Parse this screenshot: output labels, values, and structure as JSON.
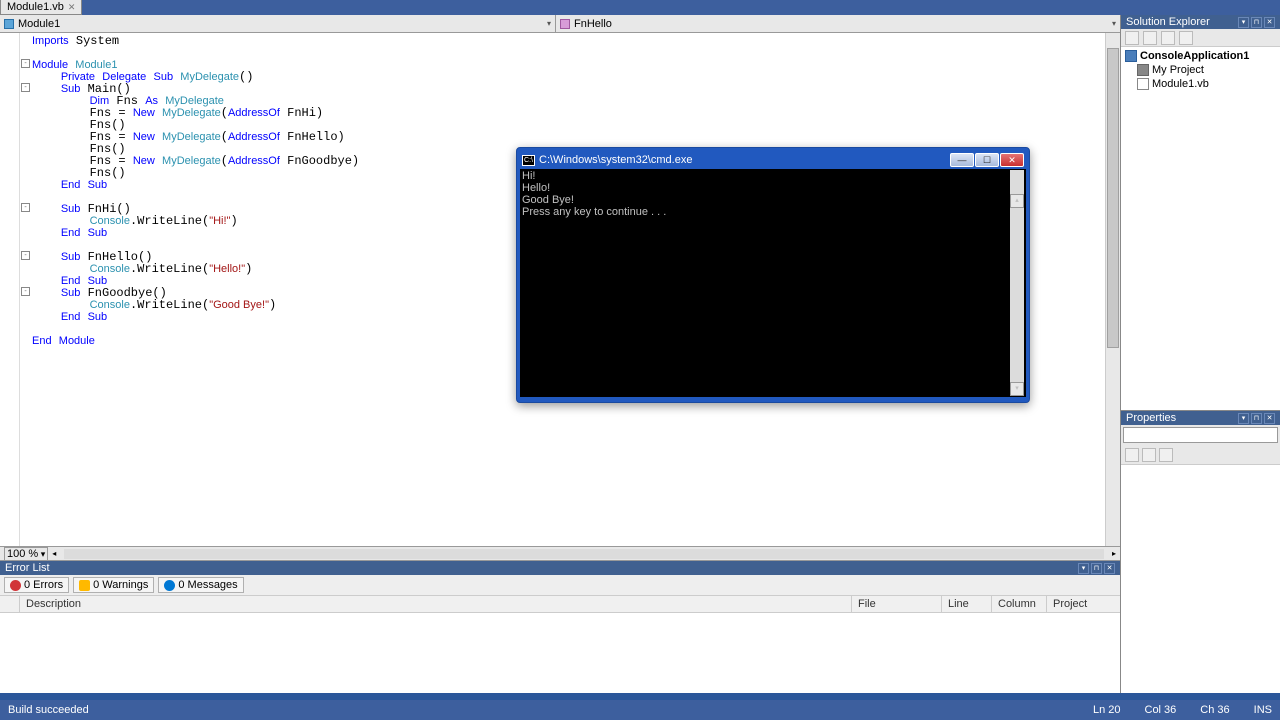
{
  "tab": {
    "name": "Module1.vb"
  },
  "dropdowns": {
    "left": "Module1",
    "right": "FnHello"
  },
  "code_tokens": [
    [
      [
        "kw",
        "Imports"
      ],
      [
        "",
        " System"
      ]
    ],
    [],
    [
      [
        "kw",
        "Module"
      ],
      [
        "",
        " "
      ],
      [
        "tp",
        "Module1"
      ]
    ],
    [
      [
        "",
        "    "
      ],
      [
        "kw",
        "Private"
      ],
      [
        "",
        " "
      ],
      [
        "kw",
        "Delegate"
      ],
      [
        "",
        " "
      ],
      [
        "kw",
        "Sub"
      ],
      [
        "",
        " "
      ],
      [
        "tp",
        "MyDelegate"
      ],
      [
        "",
        "()"
      ]
    ],
    [
      [
        "",
        "    "
      ],
      [
        "kw",
        "Sub"
      ],
      [
        "",
        " Main()"
      ]
    ],
    [
      [
        "",
        "        "
      ],
      [
        "kw",
        "Dim"
      ],
      [
        "",
        " Fns "
      ],
      [
        "kw",
        "As"
      ],
      [
        "",
        " "
      ],
      [
        "tp",
        "MyDelegate"
      ]
    ],
    [
      [
        "",
        "        Fns = "
      ],
      [
        "kw",
        "New"
      ],
      [
        "",
        " "
      ],
      [
        "tp",
        "MyDelegate"
      ],
      [
        "",
        "("
      ],
      [
        "kw",
        "AddressOf"
      ],
      [
        "",
        " FnHi)"
      ]
    ],
    [
      [
        "",
        "        Fns()"
      ]
    ],
    [
      [
        "",
        "        Fns = "
      ],
      [
        "kw",
        "New"
      ],
      [
        "",
        " "
      ],
      [
        "tp",
        "MyDelegate"
      ],
      [
        "",
        "("
      ],
      [
        "kw",
        "AddressOf"
      ],
      [
        "",
        " FnHello)"
      ]
    ],
    [
      [
        "",
        "        Fns()"
      ]
    ],
    [
      [
        "",
        "        Fns = "
      ],
      [
        "kw",
        "New"
      ],
      [
        "",
        " "
      ],
      [
        "tp",
        "MyDelegate"
      ],
      [
        "",
        "("
      ],
      [
        "kw",
        "AddressOf"
      ],
      [
        "",
        " FnGoodbye)"
      ]
    ],
    [
      [
        "",
        "        Fns()"
      ]
    ],
    [
      [
        "",
        "    "
      ],
      [
        "kw",
        "End"
      ],
      [
        "",
        " "
      ],
      [
        "kw",
        "Sub"
      ]
    ],
    [],
    [
      [
        "",
        "    "
      ],
      [
        "kw",
        "Sub"
      ],
      [
        "",
        " FnHi()"
      ]
    ],
    [
      [
        "",
        "        "
      ],
      [
        "tp",
        "Console"
      ],
      [
        "",
        ".WriteLine("
      ],
      [
        "str",
        "\"Hi!\""
      ],
      [
        "",
        ")"
      ]
    ],
    [
      [
        "",
        "    "
      ],
      [
        "kw",
        "End"
      ],
      [
        "",
        " "
      ],
      [
        "kw",
        "Sub"
      ]
    ],
    [],
    [
      [
        "",
        "    "
      ],
      [
        "kw",
        "Sub"
      ],
      [
        "",
        " FnHello()"
      ]
    ],
    [
      [
        "",
        "        "
      ],
      [
        "tp",
        "Console"
      ],
      [
        "",
        ".WriteLine("
      ],
      [
        "str",
        "\"Hello!\""
      ],
      [
        "",
        ")"
      ]
    ],
    [
      [
        "",
        "    "
      ],
      [
        "kw",
        "End"
      ],
      [
        "",
        " "
      ],
      [
        "kw",
        "Sub"
      ]
    ],
    [
      [
        "",
        "    "
      ],
      [
        "kw",
        "Sub"
      ],
      [
        "",
        " FnGoodbye()"
      ]
    ],
    [
      [
        "",
        "        "
      ],
      [
        "tp",
        "Console"
      ],
      [
        "",
        ".WriteLine("
      ],
      [
        "str",
        "\"Good Bye!\""
      ],
      [
        "",
        ")"
      ]
    ],
    [
      [
        "",
        "    "
      ],
      [
        "kw",
        "End"
      ],
      [
        "",
        " "
      ],
      [
        "kw",
        "Sub"
      ]
    ],
    [],
    [
      [
        "kw",
        "End"
      ],
      [
        "",
        " "
      ],
      [
        "kw",
        "Module"
      ]
    ]
  ],
  "folds": [
    {
      "line": 2,
      "sym": "-"
    },
    {
      "line": 4,
      "sym": "-"
    },
    {
      "line": 14,
      "sym": "-"
    },
    {
      "line": 18,
      "sym": "-"
    },
    {
      "line": 21,
      "sym": "-"
    }
  ],
  "zoom": "100 %",
  "error_list": {
    "title": "Error List",
    "errors": "0 Errors",
    "warnings": "0 Warnings",
    "messages": "0 Messages",
    "cols": {
      "desc": "Description",
      "file": "File",
      "line": "Line",
      "col": "Column",
      "proj": "Project"
    }
  },
  "solution": {
    "title": "Solution Explorer",
    "items": [
      {
        "label": "ConsoleApplication1",
        "icon": "vb",
        "bold": true,
        "level": 0
      },
      {
        "label": "My Project",
        "icon": "proj",
        "bold": false,
        "level": 1
      },
      {
        "label": "Module1.vb",
        "icon": "file",
        "bold": false,
        "level": 1
      }
    ]
  },
  "properties": {
    "title": "Properties"
  },
  "status": {
    "build": "Build succeeded",
    "ln": "Ln 20",
    "col": "Col 36",
    "ch": "Ch 36",
    "ins": "INS"
  },
  "console": {
    "title": "C:\\Windows\\system32\\cmd.exe",
    "lines": [
      "Hi!",
      "Hello!",
      "Good Bye!",
      "Press any key to continue . . ."
    ]
  }
}
